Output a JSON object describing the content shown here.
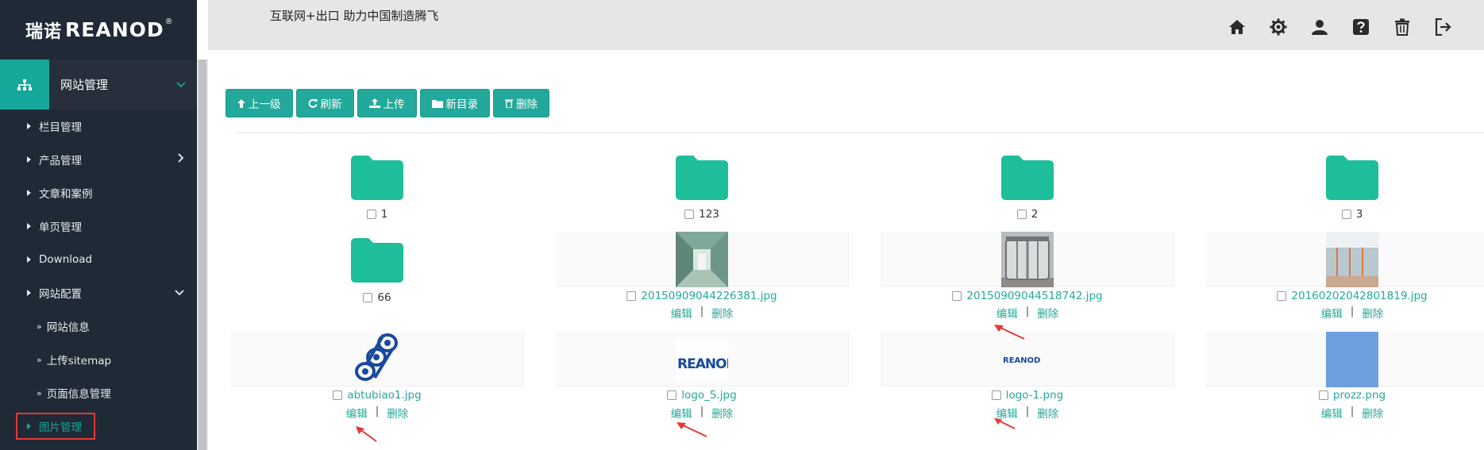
{
  "brand": {
    "cn": "瑞诺",
    "en": "REANOD",
    "reg": "®"
  },
  "header": {
    "slogan": "互联网+出口  助力中国制造腾飞"
  },
  "header_icons": [
    "home-icon",
    "settings-icon",
    "user-icon",
    "help-icon",
    "trash-icon",
    "logout-icon"
  ],
  "sidebar": {
    "section": "网站管理",
    "items": [
      {
        "label": "栏目管理",
        "sub": false,
        "arrow": ""
      },
      {
        "label": "产品管理",
        "sub": false,
        "arrow": "›"
      },
      {
        "label": "文章和案例",
        "sub": false,
        "arrow": ""
      },
      {
        "label": "单页管理",
        "sub": false,
        "arrow": ""
      },
      {
        "label": "Download",
        "sub": false,
        "arrow": ""
      },
      {
        "label": "网站配置",
        "sub": false,
        "arrow": "⌄"
      },
      {
        "label": "网站信息",
        "sub": true,
        "arrow": ""
      },
      {
        "label": "上传sitemap",
        "sub": true,
        "arrow": ""
      },
      {
        "label": "页面信息管理",
        "sub": true,
        "arrow": ""
      },
      {
        "label": "图片管理",
        "sub": false,
        "arrow": "",
        "active": true
      }
    ]
  },
  "toolbar": {
    "up": "上一级",
    "refresh": "刷新",
    "upload": "上传",
    "new_dir": "新目录",
    "delete": "删除"
  },
  "actions": {
    "edit": "编辑",
    "delete": "删除",
    "sep": "|"
  },
  "files": [
    {
      "name": "1",
      "type": "folder"
    },
    {
      "name": "123",
      "type": "folder"
    },
    {
      "name": "2",
      "type": "folder"
    },
    {
      "name": "3",
      "type": "folder"
    },
    {
      "name": "66",
      "type": "folder"
    },
    {
      "name": "20150909044226381.jpg",
      "type": "image",
      "thumb": "corridor"
    },
    {
      "name": "20150909044518742.jpg",
      "type": "image",
      "thumb": "revolving-door"
    },
    {
      "name": "20160202042801819.jpg",
      "type": "image",
      "thumb": "glass-wall"
    },
    {
      "name": "abtubiao1.jpg",
      "type": "image",
      "thumb": "rolls-logo"
    },
    {
      "name": "logo_5.jpg",
      "type": "image",
      "thumb": "reanod-logo-large"
    },
    {
      "name": "logo-1.png",
      "type": "image",
      "thumb": "reanod-logo-small"
    },
    {
      "name": "prozz.png",
      "type": "image",
      "thumb": "blue-square"
    }
  ],
  "colors": {
    "accent": "#23a99b",
    "sidebar_bg": "#1f2a36",
    "highlight": "#e53935",
    "folder": "#1dbe99"
  }
}
